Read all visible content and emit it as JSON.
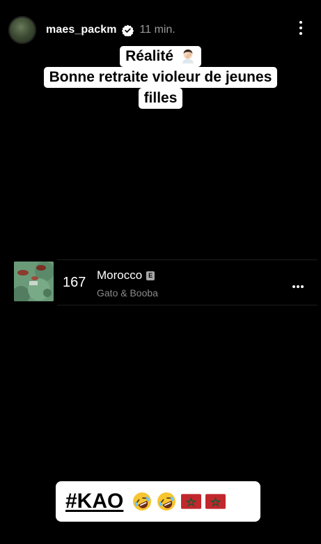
{
  "header": {
    "username": "maes_packm",
    "time": "11 min.",
    "verified_icon": "verified-badge-icon",
    "more_icon": "vertical-ellipsis-icon"
  },
  "caption": {
    "line1": "Réalité",
    "line2": "Bonne retraite violeur de jeunes",
    "line3": "filles",
    "emoji": "man-facepalming-emoji"
  },
  "track": {
    "rank": "167",
    "title": "Morocco",
    "explicit": "E",
    "artist": "Gato & Booba",
    "more_icon": "horizontal-ellipsis-icon"
  },
  "sticker": {
    "hashtag": "#KAO",
    "emojis": [
      "rolling-on-floor-laughing",
      "rolling-on-floor-laughing",
      "flag-morocco",
      "flag-morocco"
    ]
  },
  "colors": {
    "background": "#000000",
    "sticker_bg": "#ffffff",
    "muted_text": "#8a8a8a",
    "flag_red": "#c1272d",
    "flag_green": "#006233"
  }
}
